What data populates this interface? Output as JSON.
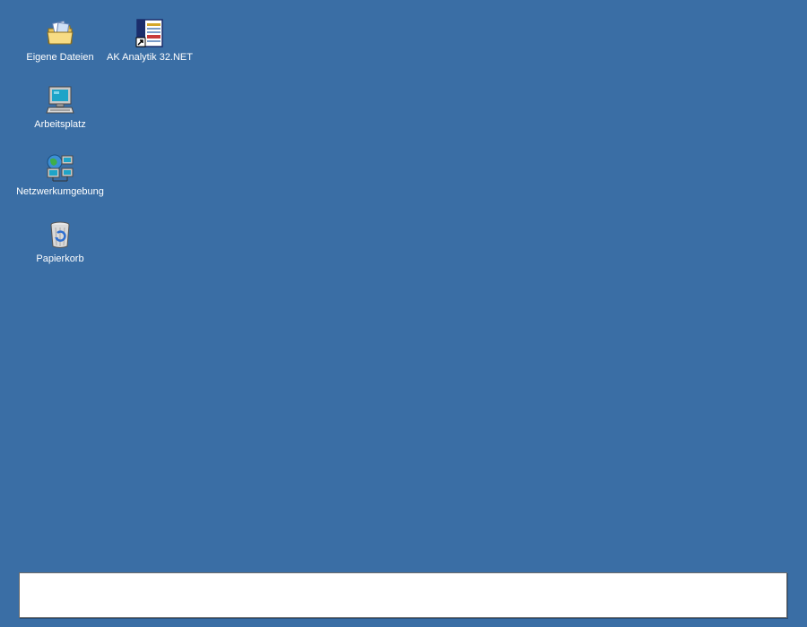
{
  "desktop": {
    "background_color": "#3a6ea5",
    "icons": [
      {
        "label": "Eigene Dateien",
        "icon": "my-documents-folder-icon"
      },
      {
        "label": "AK Analytik 32.NET",
        "icon": "app-shortcut-icon"
      },
      {
        "label": "Arbeitsplatz",
        "icon": "my-computer-icon"
      },
      {
        "label": "Netzwerkumgebung",
        "icon": "network-places-icon"
      },
      {
        "label": "Papierkorb",
        "icon": "recycle-bin-icon"
      }
    ]
  },
  "panel": {
    "text": ""
  }
}
